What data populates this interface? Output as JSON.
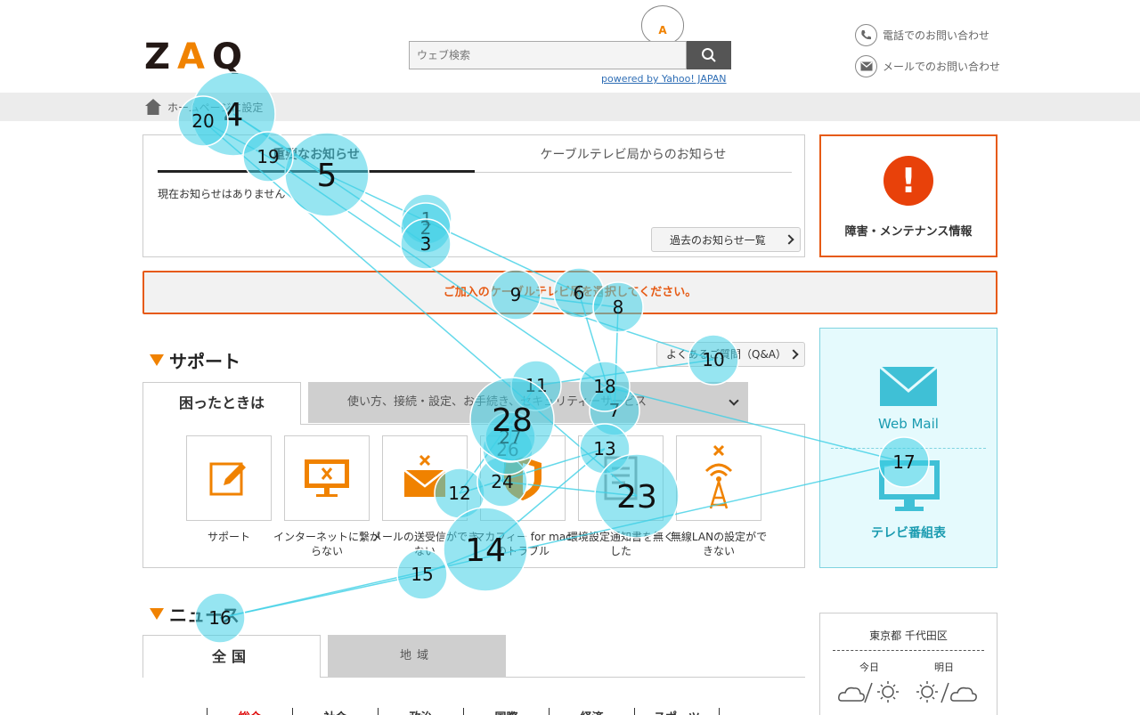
{
  "header": {
    "logo": [
      "Z",
      "A",
      "Q"
    ],
    "mascot_letter": "A",
    "search_placeholder": "ウェブ検索",
    "powered_by": "powered by Yahoo! JAPAN",
    "contact_phone": "電話でのお問い合わせ",
    "contact_mail": "メールでのお問い合わせ"
  },
  "breadcrumb": {
    "home_label": "ホームページに設定"
  },
  "notices": {
    "tab_important": "重要なお知らせ",
    "tab_station": "ケーブルテレビ局からのお知らせ",
    "empty_text": "現在お知らせはありません",
    "past_button": "過去のお知らせ一覧"
  },
  "trouble": {
    "label": "障害・メンテナンス情報"
  },
  "catv_select": "ご加入のケーブルテレビ局を選択してください。",
  "support": {
    "title": "サポート",
    "faq_button": "よくあるご質問（Q&A）",
    "tab_active": "困ったときは",
    "tab_other": "使い方、接続・設定、お手続き、セキュリティーサービス",
    "items": [
      {
        "label": "サポート",
        "icon": "pencil-icon"
      },
      {
        "label": "インターネットに繋がらない",
        "icon": "monitor-x-icon"
      },
      {
        "label": "メールの送受信ができない",
        "icon": "mail-x-icon"
      },
      {
        "label": "マカフィー for mac のトラブル",
        "icon": "shield-icon"
      },
      {
        "label": "環境設定通知書を無くした",
        "icon": "document-icon"
      },
      {
        "label": "無線LANの設定ができない",
        "icon": "wifi-tower-icon"
      }
    ]
  },
  "side": {
    "webmail": "Web Mail",
    "tv_guide": "テレビ番組表"
  },
  "news": {
    "title": "ニュース",
    "tab_national": "全国",
    "tab_local": "地域",
    "categories": [
      "総合",
      "社会",
      "政治",
      "国際",
      "経済",
      "スポーツ"
    ]
  },
  "weather": {
    "city": "東京都 千代田区",
    "today": "今日",
    "tomorrow": "明日"
  },
  "colors": {
    "accent": "#f08200",
    "alert": "#e65a14",
    "gaze": "#3fd0e6"
  },
  "gaze_points": [
    {
      "n": "1",
      "s": "m"
    },
    {
      "n": "2",
      "s": "m"
    },
    {
      "n": "3",
      "s": "m"
    },
    {
      "n": "4",
      "s": "l"
    },
    {
      "n": "5",
      "s": "l"
    },
    {
      "n": "6",
      "s": "m"
    },
    {
      "n": "7",
      "s": "m"
    },
    {
      "n": "8",
      "s": "m"
    },
    {
      "n": "9",
      "s": "m"
    },
    {
      "n": "10",
      "s": "m"
    },
    {
      "n": "11",
      "s": "m"
    },
    {
      "n": "12",
      "s": "m"
    },
    {
      "n": "13",
      "s": "m"
    },
    {
      "n": "14",
      "s": "l"
    },
    {
      "n": "15",
      "s": "m"
    },
    {
      "n": "16",
      "s": "m"
    },
    {
      "n": "17",
      "s": "m"
    },
    {
      "n": "18",
      "s": "m"
    },
    {
      "n": "19",
      "s": "m"
    },
    {
      "n": "20",
      "s": "m"
    },
    {
      "n": "23",
      "s": "l"
    },
    {
      "n": "24",
      "s": "m"
    },
    {
      "n": "26",
      "s": "m"
    },
    {
      "n": "27",
      "s": "m"
    },
    {
      "n": "28",
      "s": "l"
    }
  ]
}
